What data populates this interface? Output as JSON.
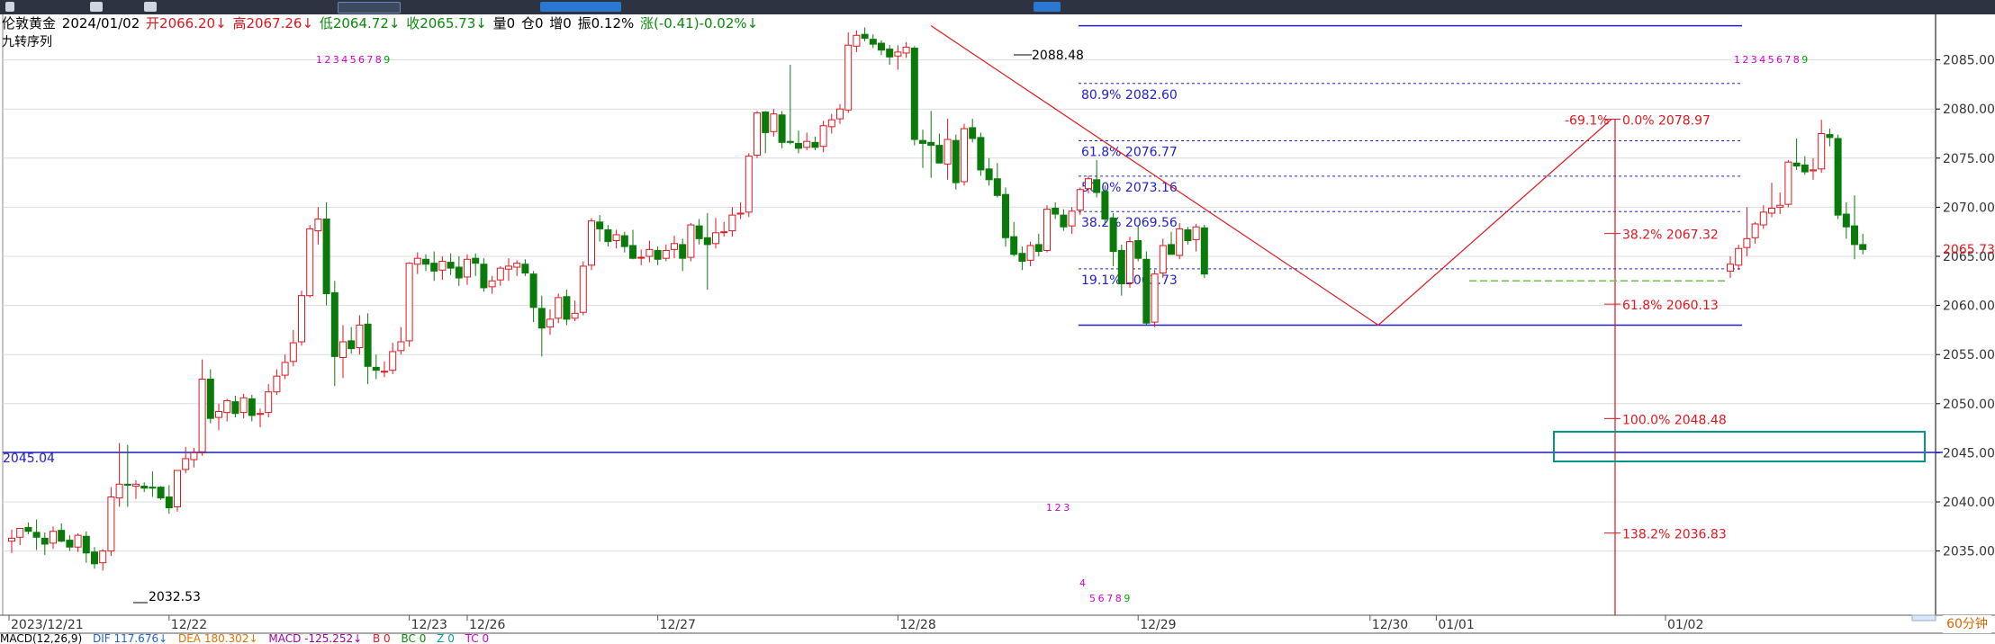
{
  "header": {
    "name": "伦敦黄金",
    "date": "2024/01/02",
    "open": "开2066.20↓",
    "high": "高2067.26↓",
    "low": "低2064.72↓",
    "close": "收2065.73↓",
    "volume": "量0",
    "position": "仓0",
    "increase": "增0",
    "amplitude": "振0.12%",
    "change": "涨(-0.41)-0.02%↓"
  },
  "indicator_title": "九转序列",
  "period": "60分钟",
  "macd": {
    "name": "MACD(12,26,9)",
    "dif": "DIF 117.676↓",
    "dea": "DEA 180.302↓",
    "macd": "MACD -125.252↓",
    "b": "B 0",
    "bc": "BC 0",
    "z": "Z 0",
    "tc": "TC 0"
  },
  "chart_data": {
    "type": "candlestick",
    "y_ticks": [
      "2085.00",
      "2080.00",
      "2075.00",
      "2070.00",
      "2065.00",
      "2060.00",
      "2055.00",
      "2050.00",
      "2045.00",
      "2040.00",
      "2035.00"
    ],
    "ylim": [
      2032,
      2090
    ],
    "x_labels": [
      {
        "label": "2023/12/21",
        "i": 0
      },
      {
        "label": "12/22",
        "i": 19
      },
      {
        "label": "12/23",
        "i": 48
      },
      {
        "label": "12/26",
        "i": 55
      },
      {
        "label": "12/27",
        "i": 78
      },
      {
        "label": "12/28",
        "i": 107
      },
      {
        "label": "12/29",
        "i": 136
      },
      {
        "label": "12/30",
        "i": 164
      },
      {
        "label": "01/01",
        "i": 172
      },
      {
        "label": "01/02",
        "i": 194
      }
    ],
    "candles": [
      [
        2036.0,
        2037.2,
        2034.8,
        2036.3
      ],
      [
        2036.4,
        2037.0,
        2035.6,
        2037.3
      ],
      [
        2037.4,
        2037.9,
        2036.7,
        2037.0
      ],
      [
        2036.9,
        2038.2,
        2035.1,
        2036.4
      ],
      [
        2036.3,
        2036.9,
        2034.6,
        2035.7
      ],
      [
        2035.8,
        2037.5,
        2035.2,
        2037.0
      ],
      [
        2037.1,
        2037.8,
        2035.9,
        2036.0
      ],
      [
        2036.1,
        2036.6,
        2035.0,
        2035.4
      ],
      [
        2035.4,
        2036.8,
        2034.9,
        2036.6
      ],
      [
        2036.5,
        2037.0,
        2033.8,
        2034.8
      ],
      [
        2034.9,
        2035.4,
        2033.2,
        2033.7
      ],
      [
        2033.8,
        2035.2,
        2033.0,
        2035.0
      ],
      [
        2035.0,
        2041.5,
        2034.5,
        2040.5
      ],
      [
        2040.4,
        2046.0,
        2039.5,
        2041.8
      ],
      [
        2041.8,
        2045.8,
        2039.5,
        2041.7
      ],
      [
        2041.6,
        2042.2,
        2040.3,
        2041.8
      ],
      [
        2041.6,
        2042.0,
        2041.0,
        2041.4
      ],
      [
        2041.5,
        2043.1,
        2040.5,
        2041.4
      ],
      [
        2041.5,
        2041.6,
        2040.2,
        2040.4
      ],
      [
        2040.5,
        2041.7,
        2038.8,
        2039.4
      ],
      [
        2039.5,
        2043.2,
        2039.0,
        2043.2
      ],
      [
        2043.3,
        2045.6,
        2042.9,
        2044.4
      ],
      [
        2044.3,
        2045.5,
        2043.5,
        2045.0
      ],
      [
        2045.1,
        2054.5,
        2044.7,
        2052.5
      ],
      [
        2052.5,
        2053.5,
        2048.0,
        2048.5
      ],
      [
        2048.6,
        2050.0,
        2047.3,
        2049.2
      ],
      [
        2049.1,
        2050.5,
        2048.2,
        2050.3
      ],
      [
        2050.2,
        2050.8,
        2048.6,
        2049.0
      ],
      [
        2049.1,
        2051.0,
        2048.5,
        2050.6
      ],
      [
        2050.5,
        2050.9,
        2048.2,
        2048.8
      ],
      [
        2048.9,
        2049.5,
        2047.6,
        2049.0
      ],
      [
        2049.1,
        2052.0,
        2048.6,
        2051.2
      ],
      [
        2051.2,
        2053.5,
        2050.9,
        2052.8
      ],
      [
        2052.9,
        2055.0,
        2052.5,
        2054.2
      ],
      [
        2054.3,
        2057.5,
        2053.8,
        2056.2
      ],
      [
        2056.3,
        2061.5,
        2055.9,
        2061.0
      ],
      [
        2061.0,
        2068.2,
        2060.8,
        2067.8
      ],
      [
        2067.6,
        2070.0,
        2066.2,
        2068.8
      ],
      [
        2068.8,
        2070.5,
        2060.0,
        2061.2
      ],
      [
        2061.3,
        2062.5,
        2051.8,
        2054.8
      ],
      [
        2054.7,
        2058.0,
        2052.6,
        2056.3
      ],
      [
        2056.4,
        2057.8,
        2055.1,
        2055.6
      ],
      [
        2055.7,
        2059.0,
        2055.0,
        2058.0
      ],
      [
        2058.1,
        2059.2,
        2052.0,
        2053.8
      ],
      [
        2053.7,
        2055.0,
        2052.5,
        2053.4
      ],
      [
        2053.3,
        2054.3,
        2052.7,
        2053.3
      ],
      [
        2053.4,
        2056.2,
        2053.0,
        2055.3
      ],
      [
        2055.4,
        2057.8,
        2055.0,
        2056.3
      ],
      [
        2056.4,
        2064.4,
        2055.8,
        2064.3
      ],
      [
        2064.2,
        2065.4,
        2063.2,
        2064.8
      ],
      [
        2064.7,
        2065.2,
        2063.5,
        2064.2
      ],
      [
        2064.3,
        2065.5,
        2062.5,
        2063.5
      ],
      [
        2063.6,
        2065.0,
        2062.6,
        2064.5
      ],
      [
        2064.4,
        2065.3,
        2063.1,
        2063.8
      ],
      [
        2063.9,
        2065.0,
        2062.0,
        2062.8
      ],
      [
        2062.9,
        2065.2,
        2062.1,
        2064.7
      ],
      [
        2064.8,
        2065.3,
        2063.0,
        2064.3
      ],
      [
        2064.2,
        2064.8,
        2061.4,
        2061.8
      ],
      [
        2061.9,
        2063.0,
        2061.2,
        2062.5
      ],
      [
        2062.6,
        2064.0,
        2062.0,
        2063.8
      ],
      [
        2063.7,
        2064.8,
        2062.5,
        2064.0
      ],
      [
        2063.9,
        2064.6,
        2063.0,
        2064.3
      ],
      [
        2064.2,
        2064.7,
        2063.0,
        2063.3
      ],
      [
        2063.2,
        2063.5,
        2058.3,
        2059.8
      ],
      [
        2059.7,
        2061.0,
        2054.8,
        2057.7
      ],
      [
        2057.8,
        2059.6,
        2057.0,
        2058.6
      ],
      [
        2058.7,
        2061.2,
        2058.2,
        2060.8
      ],
      [
        2060.9,
        2061.6,
        2058.0,
        2058.6
      ],
      [
        2058.7,
        2060.5,
        2058.4,
        2059.2
      ],
      [
        2059.3,
        2064.5,
        2059.0,
        2064.0
      ],
      [
        2064.1,
        2068.9,
        2063.6,
        2068.6
      ],
      [
        2068.5,
        2069.2,
        2066.5,
        2067.8
      ],
      [
        2067.7,
        2068.2,
        2066.0,
        2066.5
      ],
      [
        2066.6,
        2067.7,
        2065.8,
        2067.2
      ],
      [
        2067.1,
        2067.5,
        2065.4,
        2066.0
      ],
      [
        2066.1,
        2067.7,
        2064.7,
        2064.8
      ],
      [
        2064.9,
        2065.7,
        2064.1,
        2064.9
      ],
      [
        2065.0,
        2066.6,
        2064.4,
        2065.7
      ],
      [
        2065.6,
        2066.0,
        2064.1,
        2064.7
      ],
      [
        2064.8,
        2066.2,
        2064.5,
        2065.6
      ],
      [
        2065.7,
        2067.1,
        2064.8,
        2066.3
      ],
      [
        2066.2,
        2066.8,
        2063.5,
        2064.8
      ],
      [
        2064.9,
        2068.4,
        2064.5,
        2068.2
      ],
      [
        2068.1,
        2068.8,
        2066.2,
        2066.8
      ],
      [
        2066.9,
        2069.4,
        2061.6,
        2066.2
      ],
      [
        2066.3,
        2068.9,
        2065.8,
        2067.4
      ],
      [
        2067.5,
        2068.5,
        2067.0,
        2067.5
      ],
      [
        2067.6,
        2070.0,
        2067.0,
        2069.2
      ],
      [
        2069.3,
        2070.5,
        2068.8,
        2069.4
      ],
      [
        2069.5,
        2075.5,
        2069.0,
        2075.2
      ],
      [
        2075.3,
        2079.8,
        2075.0,
        2079.6
      ],
      [
        2079.7,
        2079.8,
        2075.5,
        2077.6
      ],
      [
        2077.7,
        2080.0,
        2077.2,
        2079.5
      ],
      [
        2079.4,
        2079.8,
        2076.0,
        2076.6
      ],
      [
        2076.7,
        2084.5,
        2076.4,
        2076.6
      ],
      [
        2076.5,
        2077.8,
        2075.5,
        2076.0
      ],
      [
        2076.1,
        2077.6,
        2075.8,
        2076.7
      ],
      [
        2076.6,
        2077.2,
        2075.8,
        2076.1
      ],
      [
        2076.2,
        2078.8,
        2075.6,
        2078.3
      ],
      [
        2078.2,
        2079.5,
        2077.5,
        2078.9
      ],
      [
        2079.0,
        2080.5,
        2078.5,
        2080.0
      ],
      [
        2079.9,
        2087.8,
        2079.6,
        2086.5
      ],
      [
        2086.4,
        2088.0,
        2085.8,
        2087.5
      ],
      [
        2087.6,
        2088.3,
        2086.9,
        2087.2
      ],
      [
        2087.1,
        2087.6,
        2086.2,
        2086.6
      ],
      [
        2086.7,
        2087.0,
        2085.5,
        2086.0
      ],
      [
        2086.1,
        2086.5,
        2084.5,
        2085.3
      ],
      [
        2085.4,
        2086.5,
        2084.0,
        2085.8
      ],
      [
        2085.7,
        2086.8,
        2085.2,
        2086.3
      ],
      [
        2086.2,
        2086.4,
        2076.3,
        2076.9
      ],
      [
        2076.8,
        2077.9,
        2074.0,
        2076.5
      ],
      [
        2076.6,
        2079.8,
        2073.0,
        2076.3
      ],
      [
        2076.3,
        2077.5,
        2075.5,
        2074.5
      ],
      [
        2074.4,
        2079.0,
        2072.8,
        2076.9
      ],
      [
        2076.8,
        2077.4,
        2071.8,
        2072.5
      ],
      [
        2072.6,
        2078.5,
        2072.2,
        2078.0
      ],
      [
        2078.1,
        2079.0,
        2076.6,
        2077.0
      ],
      [
        2077.1,
        2077.6,
        2073.2,
        2073.8
      ],
      [
        2073.9,
        2075.0,
        2072.2,
        2072.8
      ],
      [
        2072.9,
        2074.5,
        2071.0,
        2071.2
      ],
      [
        2071.3,
        2072.0,
        2066.0,
        2066.9
      ],
      [
        2067.0,
        2068.5,
        2065.0,
        2065.2
      ],
      [
        2065.3,
        2066.0,
        2063.6,
        2064.5
      ],
      [
        2064.6,
        2066.5,
        2064.0,
        2066.1
      ],
      [
        2066.2,
        2067.3,
        2065.0,
        2065.5
      ],
      [
        2065.6,
        2070.2,
        2065.4,
        2069.8
      ],
      [
        2069.9,
        2070.5,
        2068.8,
        2069.3
      ],
      [
        2069.2,
        2069.8,
        2067.6,
        2068.0
      ],
      [
        2068.1,
        2070.0,
        2067.3,
        2069.6
      ],
      [
        2069.7,
        2072.0,
        2069.2,
        2071.8
      ],
      [
        2071.9,
        2073.2,
        2071.4,
        2072.9
      ],
      [
        2072.8,
        2074.8,
        2071.0,
        2071.5
      ],
      [
        2071.6,
        2072.2,
        2068.2,
        2068.8
      ],
      [
        2068.9,
        2069.4,
        2064.0,
        2065.5
      ],
      [
        2065.6,
        2066.2,
        2061.0,
        2062.2
      ],
      [
        2062.3,
        2067.0,
        2061.8,
        2066.5
      ],
      [
        2066.6,
        2068.2,
        2064.5,
        2064.8
      ],
      [
        2064.7,
        2065.5,
        2058.0,
        2058.2
      ],
      [
        2058.3,
        2063.6,
        2057.8,
        2063.2
      ],
      [
        2063.3,
        2066.8,
        2062.8,
        2066.1
      ],
      [
        2066.2,
        2067.5,
        2065.6,
        2065.2
      ],
      [
        2065.1,
        2068.4,
        2064.7,
        2067.8
      ],
      [
        2067.7,
        2068.0,
        2066.2,
        2066.6
      ],
      [
        2066.7,
        2068.3,
        2065.5,
        2068.0
      ],
      [
        2067.9,
        2068.2,
        2062.8,
        2063.2
      ]
    ],
    "candles_jan02": [
      [
        2063.5,
        2065.0,
        2062.8,
        2064.2
      ],
      [
        2064.1,
        2066.2,
        2063.6,
        2065.8
      ],
      [
        2065.9,
        2070.0,
        2065.0,
        2066.8
      ],
      [
        2066.9,
        2068.5,
        2066.3,
        2068.3
      ],
      [
        2068.2,
        2070.2,
        2067.8,
        2069.5
      ],
      [
        2069.4,
        2072.5,
        2069.0,
        2069.9
      ],
      [
        2070.0,
        2071.5,
        2069.3,
        2070.2
      ],
      [
        2070.3,
        2074.8,
        2070.0,
        2074.6
      ],
      [
        2074.5,
        2077.0,
        2073.8,
        2074.2
      ],
      [
        2074.3,
        2075.2,
        2073.3,
        2073.6
      ],
      [
        2073.7,
        2075.0,
        2072.8,
        2073.8
      ],
      [
        2073.9,
        2078.9,
        2073.5,
        2077.5
      ],
      [
        2077.4,
        2078.0,
        2076.2,
        2077.1
      ],
      [
        2077.0,
        2077.4,
        2068.8,
        2069.2
      ],
      [
        2069.3,
        2070.5,
        2066.8,
        2068.0
      ],
      [
        2068.1,
        2071.2,
        2064.7,
        2066.2
      ],
      [
        2066.2,
        2067.3,
        2065.2,
        2065.7
      ]
    ],
    "high_label": "2088.48",
    "low_label": "2032.53",
    "horizontal_line": "2045.04",
    "last_price": "2065.73",
    "fib_retracement": [
      "80.9% 2082.60",
      "61.8% 2076.77",
      "50.0% 2073.16",
      "38.2% 2069.56",
      "19.1% 2063.73"
    ],
    "fib_extension": [
      "-69.1%",
      "0.0% 2078.97",
      "38.2% 2067.32",
      "61.8% 2060.13",
      "100.0% 2048.48",
      "138.2% 2036.83"
    ],
    "td_sequential": [
      "1",
      "2",
      "3",
      "4",
      "5",
      "6",
      "7",
      "8",
      "9"
    ],
    "colors": {
      "up": "#e0161e",
      "down": "#0a7a0a",
      "fib": "#2020d0",
      "ext": "#e0161e",
      "box": "#009688",
      "grid": "#dcdcdc",
      "axis": "#000000",
      "dash": "#6abf4b"
    }
  }
}
